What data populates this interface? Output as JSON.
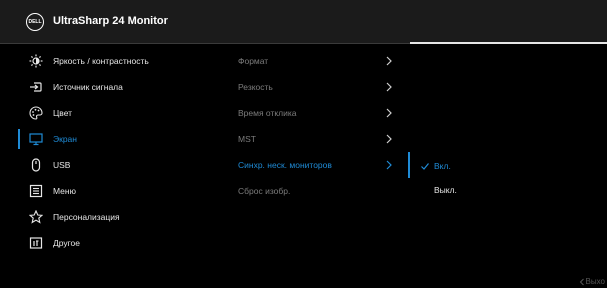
{
  "header": {
    "logo_text": "DELL",
    "title": "UltraSharp 24 Monitor"
  },
  "menu": [
    {
      "label": "Яркость / контрастность",
      "icon": "brightness-icon",
      "active": false
    },
    {
      "label": "Источник сигнала",
      "icon": "input-source-icon",
      "active": false
    },
    {
      "label": "Цвет",
      "icon": "color-icon",
      "active": false
    },
    {
      "label": "Экран",
      "icon": "display-icon",
      "active": true
    },
    {
      "label": "USB",
      "icon": "mouse-icon",
      "active": false
    },
    {
      "label": "Меню",
      "icon": "menu-icon",
      "active": false
    },
    {
      "label": "Персонализация",
      "icon": "star-icon",
      "active": false
    },
    {
      "label": "Другое",
      "icon": "info-icon",
      "active": false
    }
  ],
  "submenu": [
    {
      "label": "Формат",
      "has_arrow": true,
      "active": false
    },
    {
      "label": "Резкость",
      "has_arrow": true,
      "active": false
    },
    {
      "label": "Время отклика",
      "has_arrow": true,
      "active": false
    },
    {
      "label": "MST",
      "has_arrow": true,
      "active": false
    },
    {
      "label": "Синхр. неск. мониторов",
      "has_arrow": true,
      "active": true
    },
    {
      "label": "Сброс изобр.",
      "has_arrow": false,
      "active": false
    }
  ],
  "options": [
    {
      "label": "Вкл.",
      "selected": true
    },
    {
      "label": "Выкл.",
      "selected": false
    }
  ],
  "footer": {
    "exit_label": "Выхо"
  },
  "colors": {
    "accent": "#1f8bd6",
    "header_bg": "#1b1b1b",
    "bg": "#000000",
    "dim_text": "#7c7c7c"
  }
}
